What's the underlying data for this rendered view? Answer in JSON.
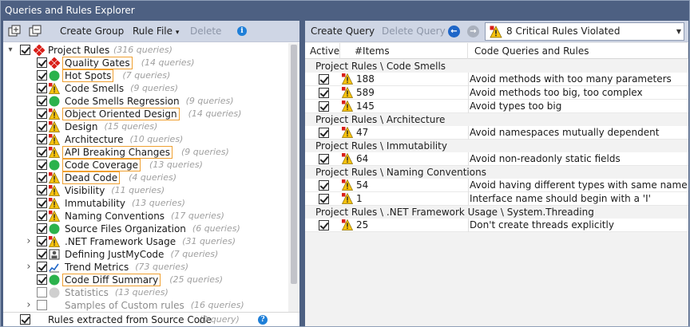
{
  "window": {
    "title": "Queries and Rules Explorer"
  },
  "left_toolbar": {
    "create_group": "Create Group",
    "rule_file": "Rule File",
    "rule_file_arrow": "▾",
    "delete": "Delete"
  },
  "tree": {
    "root": {
      "label": "Project Rules",
      "count": "(316 queries)"
    },
    "items": [
      {
        "label": "Quality Gates",
        "count": "(14 queries)",
        "icon": "quality-gate-icon",
        "boxed": true,
        "checked": true,
        "expander": false
      },
      {
        "label": "Hot Spots",
        "count": "(7 queries)",
        "icon": "green-circle-icon",
        "boxed": true,
        "checked": true,
        "expander": false
      },
      {
        "label": "Code Smells",
        "count": "(9 queries)",
        "icon": "warning-icon",
        "boxed": false,
        "checked": true,
        "expander": false
      },
      {
        "label": "Code Smells Regression",
        "count": "(9 queries)",
        "icon": "green-circle-icon",
        "boxed": false,
        "checked": true,
        "expander": false
      },
      {
        "label": "Object Oriented Design",
        "count": "(14 queries)",
        "icon": "warning-icon",
        "boxed": true,
        "checked": true,
        "expander": false
      },
      {
        "label": "Design",
        "count": "(15 queries)",
        "icon": "warning-icon",
        "boxed": false,
        "checked": true,
        "expander": false
      },
      {
        "label": "Architecture",
        "count": "(10 queries)",
        "icon": "warning-icon",
        "boxed": false,
        "checked": true,
        "expander": false
      },
      {
        "label": "API Breaking Changes",
        "count": "(9 queries)",
        "icon": "warning-icon",
        "boxed": true,
        "checked": true,
        "expander": false
      },
      {
        "label": "Code Coverage",
        "count": "(13 queries)",
        "icon": "green-circle-icon",
        "boxed": true,
        "checked": true,
        "expander": false
      },
      {
        "label": "Dead Code",
        "count": "(4 queries)",
        "icon": "warning-icon",
        "boxed": true,
        "checked": true,
        "expander": false
      },
      {
        "label": "Visibility",
        "count": "(11 queries)",
        "icon": "warning-icon",
        "boxed": false,
        "checked": true,
        "expander": false
      },
      {
        "label": "Immutability",
        "count": "(13 queries)",
        "icon": "warning-icon",
        "boxed": false,
        "checked": true,
        "expander": false
      },
      {
        "label": "Naming Conventions",
        "count": "(17 queries)",
        "icon": "warning-icon",
        "boxed": false,
        "checked": true,
        "expander": false
      },
      {
        "label": "Source Files Organization",
        "count": "(6 queries)",
        "icon": "green-circle-icon",
        "boxed": false,
        "checked": true,
        "expander": false
      },
      {
        "label": ".NET Framework Usage",
        "count": "(31 queries)",
        "icon": "warning-icon",
        "boxed": false,
        "checked": true,
        "expander": true
      },
      {
        "label": "Defining JustMyCode",
        "count": "(7 queries)",
        "icon": "justmycode-icon",
        "boxed": false,
        "checked": true,
        "expander": false
      },
      {
        "label": "Trend Metrics",
        "count": "(73 queries)",
        "icon": "trend-chart-icon",
        "boxed": false,
        "checked": true,
        "expander": true
      },
      {
        "label": "Code Diff Summary",
        "count": "(25 queries)",
        "icon": "green-circle-icon",
        "boxed": true,
        "checked": true,
        "expander": false
      },
      {
        "label": "Statistics",
        "count": "(13 queries)",
        "icon": "gray-circle-icon",
        "boxed": false,
        "checked": false,
        "expander": false,
        "dim": true
      },
      {
        "label": "Samples of Custom rules",
        "count": "(16 queries)",
        "icon": "none",
        "boxed": false,
        "checked": false,
        "expander": true,
        "dim": true
      }
    ],
    "bottom": {
      "label": "Rules extracted from Source Code",
      "count": "(0 query)"
    }
  },
  "right_toolbar": {
    "create_query": "Create Query",
    "delete_query": "Delete Query",
    "status_combo": "8 Critical Rules Violated"
  },
  "grid": {
    "headers": {
      "active": "Active",
      "items": "#Items",
      "name": "Code Queries and Rules"
    },
    "groups": [
      {
        "title": "Project Rules \\ Code Smells",
        "rows": [
          {
            "count": "188",
            "name": "Avoid methods with too many parameters"
          },
          {
            "count": "589",
            "name": "Avoid methods too big, too complex"
          },
          {
            "count": "145",
            "name": "Avoid types too big"
          }
        ]
      },
      {
        "title": "Project Rules \\ Architecture",
        "rows": [
          {
            "count": "47",
            "name": "Avoid namespaces mutually dependent"
          }
        ]
      },
      {
        "title": "Project Rules \\ Immutability",
        "rows": [
          {
            "count": "64",
            "name": "Avoid non-readonly static fields"
          }
        ]
      },
      {
        "title": "Project Rules \\ Naming Conventions",
        "rows": [
          {
            "count": "54",
            "name": "Avoid having different types with same name"
          },
          {
            "count": "1",
            "name": "Interface name should begin with a 'I'"
          }
        ]
      },
      {
        "title": "Project Rules \\ .NET Framework Usage \\ System.Threading",
        "rows": [
          {
            "count": "25",
            "name": "Don't create threads explicitly"
          }
        ]
      }
    ]
  },
  "colors": {
    "chrome": "#4d6082",
    "toolbar": "#cfd6e5",
    "highlight_box": "#f0a030",
    "warning_yellow": "#f7c20e",
    "warning_red": "#d91e18",
    "ok_green": "#2bb24c",
    "nav_blue": "#1e66c8"
  }
}
